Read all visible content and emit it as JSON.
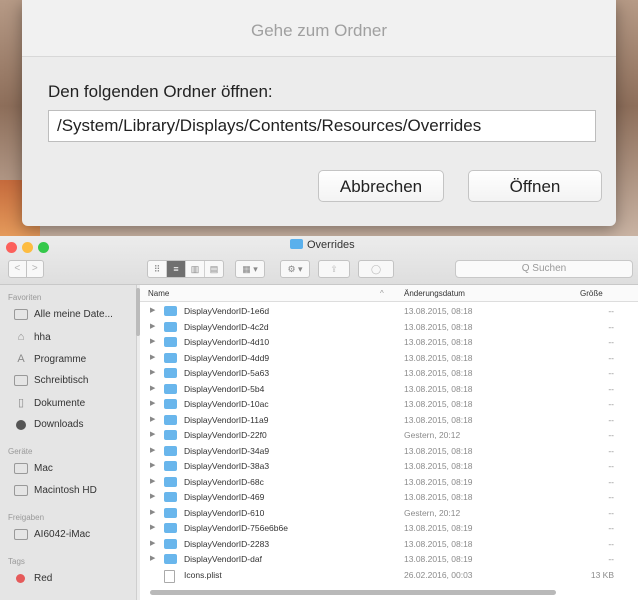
{
  "dialog": {
    "title": "Gehe zum Ordner",
    "prompt": "Den folgenden Ordner öffnen:",
    "path_value": "/System/Library/Displays/Contents/Resources/Overrides",
    "cancel_label": "Abbrechen",
    "open_label": "Öffnen"
  },
  "finder": {
    "title": "Overrides",
    "nav_back": "<",
    "nav_forward": ">",
    "view_icons": [
      "⠿",
      "≡",
      "▥",
      "▤"
    ],
    "arrange_icon": "▦ ▾",
    "action_icon": "⚙ ▾",
    "share_icon": "⇪",
    "tag_icon": "◯",
    "search_placeholder": "Q Suchen",
    "sidebar": {
      "favorites_header": "Favoriten",
      "favorites": [
        "Alle meine Date...",
        "hha",
        "Programme",
        "Schreibtisch",
        "Dokumente",
        "Downloads"
      ],
      "devices_header": "Geräte",
      "devices": [
        "Mac",
        "Macintosh HD"
      ],
      "shared_header": "Freigaben",
      "shared": [
        "AI6042-iMac"
      ],
      "tags_header": "Tags",
      "tags": [
        "Red"
      ]
    },
    "columns": {
      "name": "Name",
      "date": "Änderungsdatum",
      "size": "Größe",
      "sort_arrow": "^"
    },
    "rows": [
      {
        "name": "DisplayVendorID-1e6d",
        "date": "13.08.2015, 08:18",
        "size": "--"
      },
      {
        "name": "DisplayVendorID-4c2d",
        "date": "13.08.2015, 08:18",
        "size": "--"
      },
      {
        "name": "DisplayVendorID-4d10",
        "date": "13.08.2015, 08:18",
        "size": "--"
      },
      {
        "name": "DisplayVendorID-4dd9",
        "date": "13.08.2015, 08:18",
        "size": "--"
      },
      {
        "name": "DisplayVendorID-5a63",
        "date": "13.08.2015, 08:18",
        "size": "--"
      },
      {
        "name": "DisplayVendorID-5b4",
        "date": "13.08.2015, 08:18",
        "size": "--"
      },
      {
        "name": "DisplayVendorID-10ac",
        "date": "13.08.2015, 08:18",
        "size": "--"
      },
      {
        "name": "DisplayVendorID-11a9",
        "date": "13.08.2015, 08:18",
        "size": "--"
      },
      {
        "name": "DisplayVendorID-22f0",
        "date": "Gestern, 20:12",
        "size": "--"
      },
      {
        "name": "DisplayVendorID-34a9",
        "date": "13.08.2015, 08:18",
        "size": "--"
      },
      {
        "name": "DisplayVendorID-38a3",
        "date": "13.08.2015, 08:18",
        "size": "--"
      },
      {
        "name": "DisplayVendorID-68c",
        "date": "13.08.2015, 08:19",
        "size": "--"
      },
      {
        "name": "DisplayVendorID-469",
        "date": "13.08.2015, 08:18",
        "size": "--"
      },
      {
        "name": "DisplayVendorID-610",
        "date": "Gestern, 20:12",
        "size": "--"
      },
      {
        "name": "DisplayVendorID-756e6b6e",
        "date": "13.08.2015, 08:19",
        "size": "--"
      },
      {
        "name": "DisplayVendorID-2283",
        "date": "13.08.2015, 08:18",
        "size": "--"
      },
      {
        "name": "DisplayVendorID-daf",
        "date": "13.08.2015, 08:19",
        "size": "--"
      },
      {
        "name": "Icons.plist",
        "date": "26.02.2016, 00:03",
        "size": "13 KB"
      }
    ]
  }
}
